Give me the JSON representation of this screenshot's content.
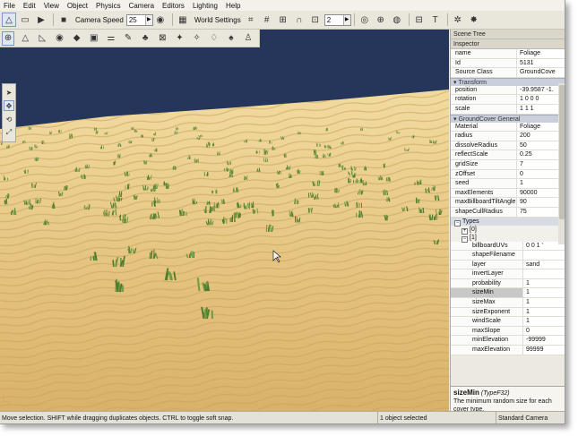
{
  "menu": [
    "File",
    "Edit",
    "View",
    "Object",
    "Physics",
    "Camera",
    "Editors",
    "Lighting",
    "Help"
  ],
  "toolbar": {
    "camera_speed_label": "Camera Speed",
    "camera_speed_value": "25",
    "world_settings_label": "World Settings",
    "snap_value": "2"
  },
  "icons": {
    "terrain_tools": [
      "terrain-editor-icon",
      "raise-icon",
      "lower-icon",
      "smooth-icon",
      "paint-icon",
      "flatten-icon",
      "height-icon",
      "noise-icon",
      "brush-icon",
      "paint-material-icon",
      "resize-icon",
      "select-icon",
      "fill-icon",
      "erode-icon",
      "settings-icon"
    ]
  },
  "scene_tree": {
    "title": "Scene Tree"
  },
  "inspector": {
    "title": "Inspector",
    "rows": [
      {
        "k": "name",
        "v": "Foliage"
      },
      {
        "k": "Id",
        "v": "5131"
      },
      {
        "k": "Source Class",
        "v": "GroundCove"
      }
    ],
    "transform_title": "Transform",
    "transform": [
      {
        "k": "position",
        "v": "-39.9587 -1."
      },
      {
        "k": "rotation",
        "v": "1 0 0 0"
      },
      {
        "k": "scale",
        "v": "1 1 1"
      }
    ],
    "gc_title": "GroundCover General",
    "gc": [
      {
        "k": "Material",
        "v": "Foliage"
      },
      {
        "k": "radius",
        "v": "200"
      },
      {
        "k": "dissolveRadius",
        "v": "50"
      },
      {
        "k": "reflectScale",
        "v": "0.25"
      },
      {
        "k": "gridSize",
        "v": "7"
      },
      {
        "k": "zOffset",
        "v": "0"
      },
      {
        "k": "seed",
        "v": "1"
      },
      {
        "k": "maxElements",
        "v": "90000"
      },
      {
        "k": "maxBillboardTiltAngle",
        "v": "90"
      },
      {
        "k": "shapeCullRadius",
        "v": "75"
      }
    ],
    "types_title": "Types",
    "type0": "[0]",
    "type1": "[1]",
    "type_rows": [
      {
        "k": "billboardUVs",
        "v": "0 0 1 '"
      },
      {
        "k": "shapeFilename",
        "v": ""
      },
      {
        "k": "layer",
        "v": "sand"
      },
      {
        "k": "invertLayer",
        "v": ""
      },
      {
        "k": "probability",
        "v": "1"
      },
      {
        "k": "sizeMin",
        "v": "1"
      },
      {
        "k": "sizeMax",
        "v": "1"
      },
      {
        "k": "sizeExponent",
        "v": "1"
      },
      {
        "k": "windScale",
        "v": "1"
      },
      {
        "k": "maxSlope",
        "v": "0"
      },
      {
        "k": "minElevation",
        "v": "-99999"
      },
      {
        "k": "maxElevation",
        "v": "99999"
      }
    ],
    "help_title": "sizeMin",
    "help_type": "(TypeF32)",
    "help_text": "The minimum random size for each cover type."
  },
  "status": {
    "hint": "Move selection.  SHIFT while dragging duplicates objects.  CTRL to toggle soft snap.",
    "selection": "1 object selected",
    "camera": "Standard Camera"
  },
  "colors": {
    "sky": "#25365a",
    "sand": "#e3c27d",
    "sand_shadow": "#c9a05a",
    "plant": "#4f7a2e"
  }
}
